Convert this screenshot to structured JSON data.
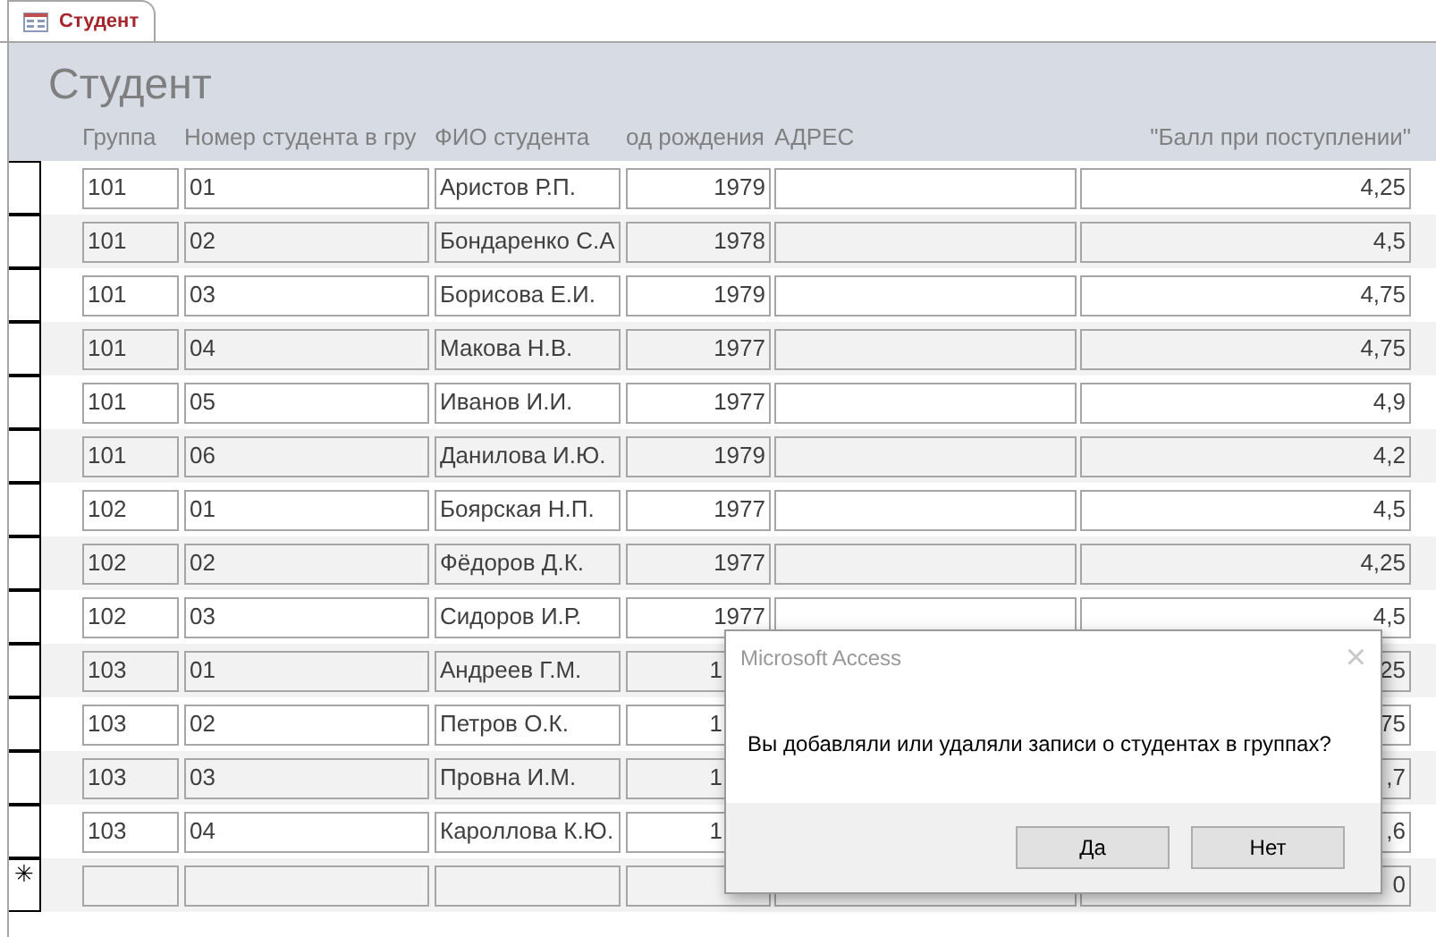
{
  "tab": {
    "label": "Студент",
    "selected": true
  },
  "form_title": "Студент",
  "columns": [
    "Группа",
    "Номер студента в гру",
    "ФИО студента",
    "од рождения",
    "АДРЕС",
    "\"Балл при поступлении\""
  ],
  "rows": [
    {
      "kind": "record",
      "group": "101",
      "number": "01",
      "name": "Аристов Р.П.",
      "year": "1979",
      "score": "4,25",
      "covered": false
    },
    {
      "kind": "record",
      "group": "101",
      "number": "02",
      "name": "Бондаренко С.А",
      "year": "1978",
      "score": "4,5",
      "covered": false
    },
    {
      "kind": "record",
      "group": "101",
      "number": "03",
      "name": "Борисова Е.И.",
      "year": "1979",
      "score": "4,75",
      "covered": false
    },
    {
      "kind": "record",
      "group": "101",
      "number": "04",
      "name": "Макова Н.В.",
      "year": "1977",
      "score": "4,75",
      "covered": false
    },
    {
      "kind": "record",
      "group": "101",
      "number": "05",
      "name": "Иванов И.И.",
      "year": "1977",
      "score": "4,9",
      "covered": false
    },
    {
      "kind": "record",
      "group": "101",
      "number": "06",
      "name": "Данилова И.Ю.",
      "year": "1979",
      "score": "4,2",
      "covered": false
    },
    {
      "kind": "record",
      "group": "102",
      "number": "01",
      "name": "Боярская Н.П.",
      "year": "1977",
      "score": "4,5",
      "covered": false
    },
    {
      "kind": "record",
      "group": "102",
      "number": "02",
      "name": "Фёдоров Д.К.",
      "year": "1977",
      "score": "4,25",
      "covered": false
    },
    {
      "kind": "record",
      "group": "102",
      "number": "03",
      "name": "Сидоров И.Р.",
      "year": "1977",
      "score": "4,5",
      "covered": false
    },
    {
      "kind": "record",
      "group": "103",
      "number": "01",
      "name": "Андреев Г.М.",
      "year": "1",
      "score": "25",
      "covered": true
    },
    {
      "kind": "record",
      "group": "103",
      "number": "02",
      "name": "Петров О.К.",
      "year": "1",
      "score": "75",
      "covered": true
    },
    {
      "kind": "record",
      "group": "103",
      "number": "03",
      "name": "Провна И.М.",
      "year": "1",
      "score": ",7",
      "covered": true
    },
    {
      "kind": "record",
      "group": "103",
      "number": "04",
      "name": "Кароллова К.Ю.",
      "year": "1",
      "score": ",6",
      "covered": true
    },
    {
      "kind": "new",
      "marker": "✳",
      "score": "0"
    }
  ],
  "dialog": {
    "title": "Microsoft Access",
    "close": "×",
    "message": "Вы добавляли или удаляли записи о студентах в группах?",
    "buttons": [
      "Да",
      "Нет"
    ]
  }
}
